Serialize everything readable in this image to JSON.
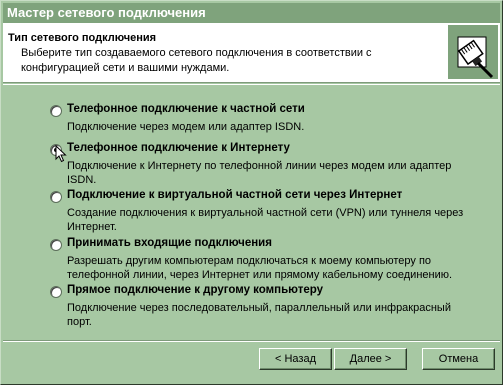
{
  "window": {
    "title": "Мастер сетевого подключения"
  },
  "header": {
    "title": "Тип сетевого подключения",
    "subtitle": "Выберите тип создаваемого сетевого подключения в соответствии с конфигурацией сети и вашими нуждами.",
    "icon": "network-cable-icon"
  },
  "options": [
    {
      "label": "Телефонное подключение к частной сети",
      "description": "Подключение через модем или адаптер ISDN.",
      "selected": false
    },
    {
      "label": "Телефонное подключение к Интернету",
      "description": "Подключение к Интернету по телефонной линии через модем или адаптер ISDN.",
      "selected": true
    },
    {
      "label": "Подключение к виртуальной частной сети через Интернет",
      "description": "Создание подключения к виртуальной частной сети (VPN) или туннеля через Интернет.",
      "selected": false
    },
    {
      "label": "Принимать входящие подключения",
      "description": "Разрешать другим компьютерам подключаться к моему компьютеру по телефонной линии, через Интернет или прямому кабельному соединению.",
      "selected": false
    },
    {
      "label": "Прямое подключение к другому компьютеру",
      "description": "Подключение через последовательный, параллельный или инфракрасный порт.",
      "selected": false
    }
  ],
  "buttons": {
    "back": "< Назад",
    "next": "Далее >",
    "cancel": "Отмена"
  },
  "colors": {
    "face": "#a7c8a3",
    "titlebar": "#7fa37c",
    "header_bg": "#ffffff"
  }
}
